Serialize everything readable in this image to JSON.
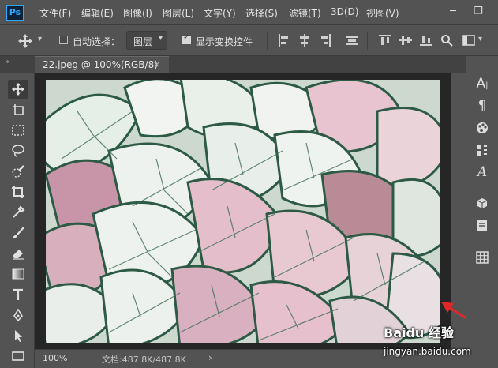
{
  "app": {
    "logo": "Ps"
  },
  "menu": [
    "文件(F)",
    "编辑(E)",
    "图像(I)",
    "图层(L)",
    "文字(Y)",
    "选择(S)",
    "滤镜(T)",
    "3D(D)",
    "视图(V)"
  ],
  "window_controls": {
    "minimize": "─",
    "restore": "❐"
  },
  "options": {
    "auto_select_label": "自动选择：",
    "auto_select_checked": false,
    "layer_select_value": "图层",
    "show_transform_label": "显示变换控件",
    "show_transform_checked": true
  },
  "document": {
    "tab_title": "22.jpeg @ 100%(RGB/8)",
    "close_glyph": "×"
  },
  "status": {
    "zoom": "100%",
    "doc_size": "文档:487.8K/487.8K",
    "arrow": "›"
  },
  "watermark": {
    "logo_text": "Baidu 经验",
    "url": "jingyan.baidu.com"
  },
  "colors": {
    "accent_ps": "#31a8ff",
    "annotation_arrow": "#e0282b",
    "ui_bg": "#535353",
    "canvas_bg": "#262626"
  }
}
